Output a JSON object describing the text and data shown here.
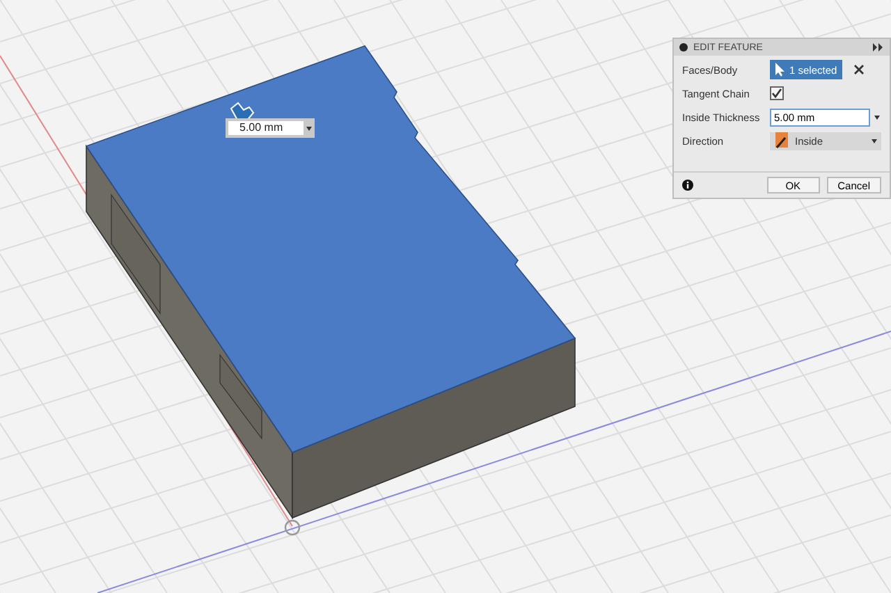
{
  "canvas_dimension": {
    "value": "5.00 mm"
  },
  "dialog": {
    "title": "EDIT FEATURE",
    "rows": [
      {
        "kind": "selection",
        "label": "Faces/Body",
        "value": "1 selected"
      },
      {
        "kind": "checkbox",
        "label": "Tangent Chain",
        "checked": true
      },
      {
        "kind": "input",
        "label": "Inside Thickness",
        "value": "5.00 mm"
      },
      {
        "kind": "dropdown",
        "label": "Direction",
        "value": "Inside"
      }
    ],
    "buttons": [
      "OK",
      "Cancel"
    ]
  }
}
